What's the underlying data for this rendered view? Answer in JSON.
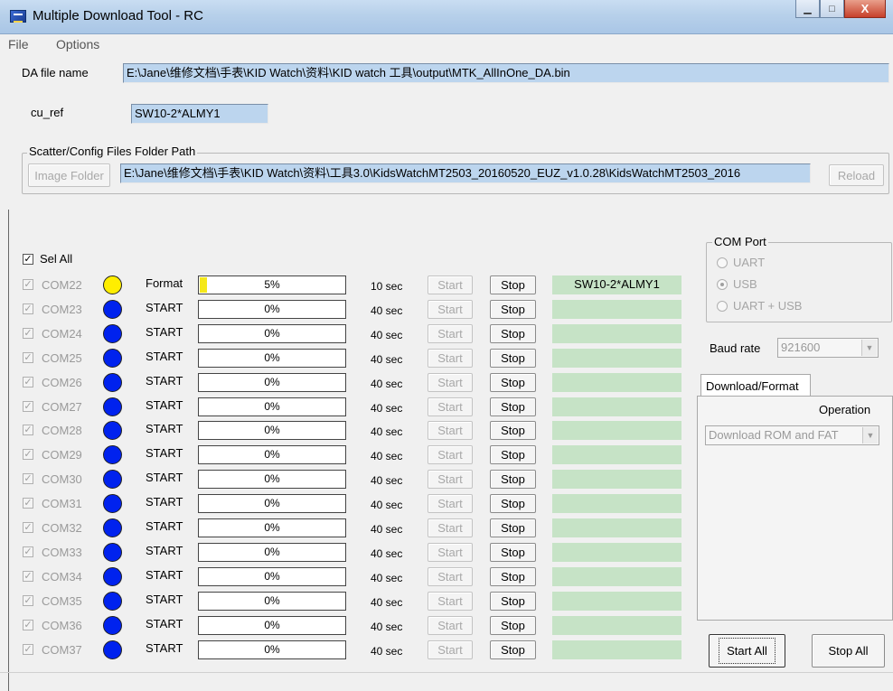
{
  "window": {
    "title": "Multiple Download Tool - RC",
    "minimize": "▁",
    "maximize": "□",
    "close": "X"
  },
  "menu": [
    "File",
    "Options"
  ],
  "da_file": {
    "label": "DA file name",
    "value": "E:\\Jane\\维修文档\\手表\\KID Watch\\资料\\KID watch 工具\\output\\MTK_AllInOne_DA.bin"
  },
  "cu_ref": {
    "label": "cu_ref",
    "value": "SW10-2*ALMY1"
  },
  "scatter": {
    "legend": "Scatter/Config Files Folder Path",
    "image_folder_button": "Image Folder",
    "path": "E:\\Jane\\维修文档\\手表\\KID Watch\\资料\\工具3.0\\KidsWatchMT2503_20160520_EUZ_v1.0.28\\KidsWatchMT2503_2016",
    "reload_button": "Reload"
  },
  "sel_all": {
    "label": "Sel All",
    "checked": true
  },
  "rows": [
    {
      "com": "COM22",
      "led_color": "#ffee00",
      "status": "Format",
      "progress": 5,
      "progress_text": "5%",
      "time": "10 sec",
      "start": "Start",
      "stop": "Stop",
      "result": "SW10-2*ALMY1"
    },
    {
      "com": "COM23",
      "led_color": "#0022ee",
      "status": "START",
      "progress": 0,
      "progress_text": "0%",
      "time": "40 sec",
      "start": "Start",
      "stop": "Stop",
      "result": ""
    },
    {
      "com": "COM24",
      "led_color": "#0022ee",
      "status": "START",
      "progress": 0,
      "progress_text": "0%",
      "time": "40 sec",
      "start": "Start",
      "stop": "Stop",
      "result": ""
    },
    {
      "com": "COM25",
      "led_color": "#0022ee",
      "status": "START",
      "progress": 0,
      "progress_text": "0%",
      "time": "40 sec",
      "start": "Start",
      "stop": "Stop",
      "result": ""
    },
    {
      "com": "COM26",
      "led_color": "#0022ee",
      "status": "START",
      "progress": 0,
      "progress_text": "0%",
      "time": "40 sec",
      "start": "Start",
      "stop": "Stop",
      "result": ""
    },
    {
      "com": "COM27",
      "led_color": "#0022ee",
      "status": "START",
      "progress": 0,
      "progress_text": "0%",
      "time": "40 sec",
      "start": "Start",
      "stop": "Stop",
      "result": ""
    },
    {
      "com": "COM28",
      "led_color": "#0022ee",
      "status": "START",
      "progress": 0,
      "progress_text": "0%",
      "time": "40 sec",
      "start": "Start",
      "stop": "Stop",
      "result": ""
    },
    {
      "com": "COM29",
      "led_color": "#0022ee",
      "status": "START",
      "progress": 0,
      "progress_text": "0%",
      "time": "40 sec",
      "start": "Start",
      "stop": "Stop",
      "result": ""
    },
    {
      "com": "COM30",
      "led_color": "#0022ee",
      "status": "START",
      "progress": 0,
      "progress_text": "0%",
      "time": "40 sec",
      "start": "Start",
      "stop": "Stop",
      "result": ""
    },
    {
      "com": "COM31",
      "led_color": "#0022ee",
      "status": "START",
      "progress": 0,
      "progress_text": "0%",
      "time": "40 sec",
      "start": "Start",
      "stop": "Stop",
      "result": ""
    },
    {
      "com": "COM32",
      "led_color": "#0022ee",
      "status": "START",
      "progress": 0,
      "progress_text": "0%",
      "time": "40 sec",
      "start": "Start",
      "stop": "Stop",
      "result": ""
    },
    {
      "com": "COM33",
      "led_color": "#0022ee",
      "status": "START",
      "progress": 0,
      "progress_text": "0%",
      "time": "40 sec",
      "start": "Start",
      "stop": "Stop",
      "result": ""
    },
    {
      "com": "COM34",
      "led_color": "#0022ee",
      "status": "START",
      "progress": 0,
      "progress_text": "0%",
      "time": "40 sec",
      "start": "Start",
      "stop": "Stop",
      "result": ""
    },
    {
      "com": "COM35",
      "led_color": "#0022ee",
      "status": "START",
      "progress": 0,
      "progress_text": "0%",
      "time": "40 sec",
      "start": "Start",
      "stop": "Stop",
      "result": ""
    },
    {
      "com": "COM36",
      "led_color": "#0022ee",
      "status": "START",
      "progress": 0,
      "progress_text": "0%",
      "time": "40 sec",
      "start": "Start",
      "stop": "Stop",
      "result": ""
    },
    {
      "com": "COM37",
      "led_color": "#0022ee",
      "status": "START",
      "progress": 0,
      "progress_text": "0%",
      "time": "40 sec",
      "start": "Start",
      "stop": "Stop",
      "result": ""
    }
  ],
  "com_port": {
    "legend": "COM Port",
    "options": [
      "UART",
      "USB",
      "UART + USB"
    ],
    "selected": "USB"
  },
  "baud": {
    "label": "Baud rate",
    "value": "921600"
  },
  "tab": {
    "label": "Download/Format"
  },
  "operation": {
    "label": "Operation",
    "value": "Download ROM and FAT"
  },
  "buttons": {
    "start_all": "Start All",
    "stop_all": "Stop All"
  },
  "colors": {
    "result_bg": "#c6e3c6",
    "field_bg": "#bcd5ee",
    "progress_fill": "#f5e81a"
  }
}
